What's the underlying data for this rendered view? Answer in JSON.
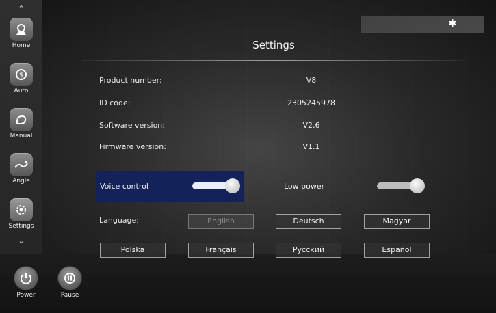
{
  "sidebar": {
    "items": [
      {
        "label": "Home",
        "icon": "home-icon"
      },
      {
        "label": "Auto",
        "icon": "auto-icon"
      },
      {
        "label": "Manual",
        "icon": "manual-icon"
      },
      {
        "label": "Angle",
        "icon": "angle-icon"
      },
      {
        "label": "Settings",
        "icon": "settings-icon",
        "active": true
      }
    ],
    "scroll_up": "⌃",
    "scroll_down": "⌄"
  },
  "controls": {
    "power_label": "Power",
    "pause_label": "Pause"
  },
  "header": {
    "title": "Settings",
    "status_icon": "bluetooth-icon"
  },
  "info": [
    {
      "label": "Product number:",
      "value": "V8"
    },
    {
      "label": "ID code:",
      "value": "2305245978"
    },
    {
      "label": "Software version:",
      "value": "V2.6"
    },
    {
      "label": "Firmware version:",
      "value": "V1.1"
    }
  ],
  "toggles": {
    "voice_control": {
      "label": "Voice control",
      "on": true
    },
    "low_power": {
      "label": "Low power",
      "on": false
    }
  },
  "language": {
    "label": "Language:",
    "selected": "English",
    "options": [
      "English",
      "Deutsch",
      "Magyar",
      "Polska",
      "Français",
      "Русский",
      "Español"
    ]
  },
  "colors": {
    "panel_highlight": "#14225a",
    "background": "#2a2a2a"
  }
}
